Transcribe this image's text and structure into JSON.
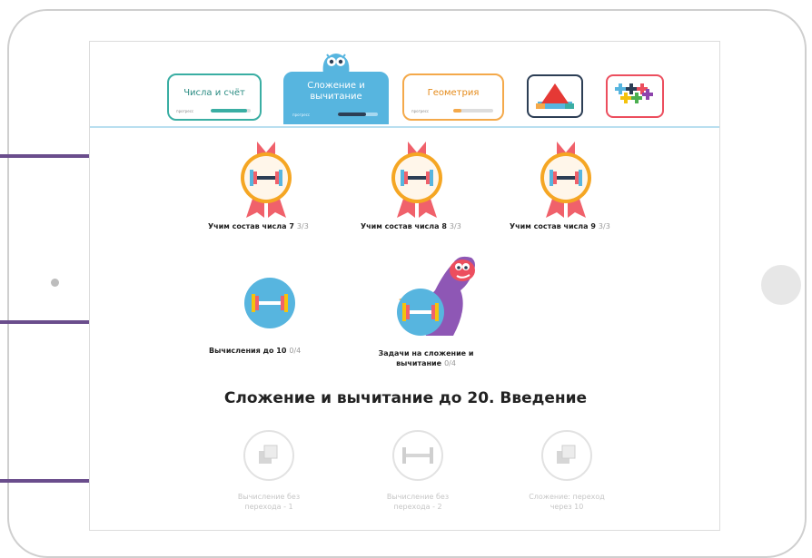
{
  "tabs": [
    {
      "label": "Числа и счёт",
      "progress_caption": "прогресс",
      "progress": 0.9,
      "color": "#3aaea3"
    },
    {
      "label": "Сложение и вычитание",
      "progress_caption": "прогресс",
      "progress": 0.7,
      "color": "#57b5df"
    },
    {
      "label": "Геометрия",
      "progress_caption": "прогресс",
      "progress": 0.2,
      "color": "#f4a94a"
    }
  ],
  "skills_completed": [
    {
      "label": "Учим состав числа 7",
      "count": "3/3"
    },
    {
      "label": "Учим состав числа 8",
      "count": "3/3"
    },
    {
      "label": "Учим состав числа 9",
      "count": "3/3"
    }
  ],
  "skills_available": [
    {
      "label": "Вычисления до 10",
      "count": "0/4"
    },
    {
      "label": "Задачи на сложение и вычитание",
      "count": "0/4"
    }
  ],
  "section_title": "Сложение и вычитание до 20. Введение",
  "skills_locked": [
    {
      "label": "Вычисление без перехода - 1"
    },
    {
      "label": "Вычисление без перехода - 2"
    },
    {
      "label": "Сложение: переход через 10"
    }
  ],
  "colors": {
    "accent": "#6a4d8c",
    "medal": "#f5a623",
    "ribbon": "#f0616b",
    "blue": "#57b5df"
  }
}
